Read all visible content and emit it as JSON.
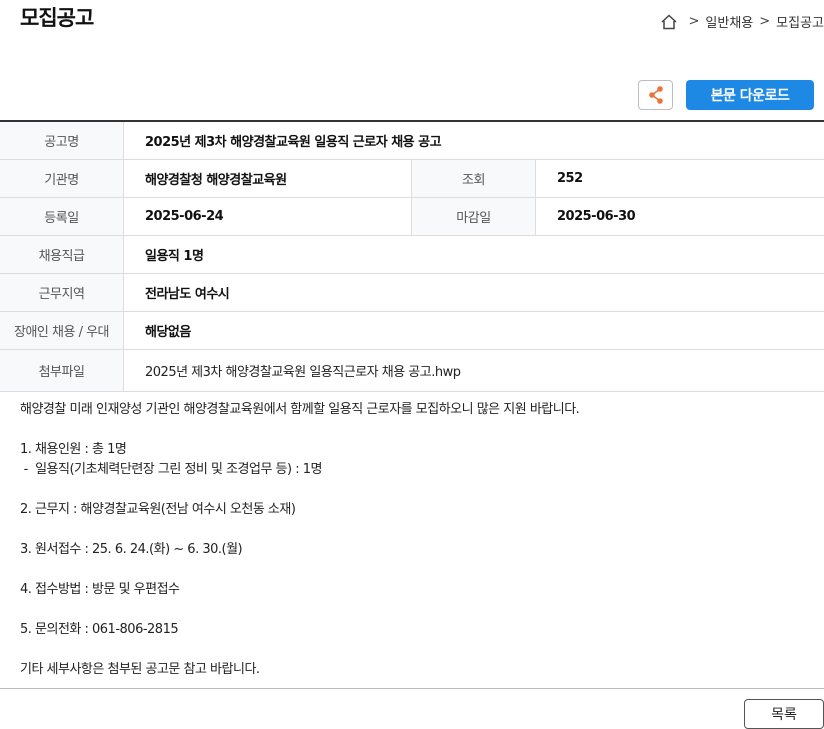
{
  "header": {
    "title": "모집공고",
    "breadcrumb": [
      "일반채용",
      "모집공고"
    ],
    "breadcrumb_sep": ">"
  },
  "toolbar": {
    "download_label": "본문 다운로드"
  },
  "info": {
    "title_label": "공고명",
    "title_value": "2025년 제3차 해양경찰교육원 일용직 근로자 채용 공고",
    "org_label": "기관명",
    "org_value": "해양경찰청 해양경찰교육원",
    "views_label": "조회",
    "views_value": "252",
    "reg_label": "등록일",
    "reg_value": "2025-06-24",
    "deadline_label": "마감일",
    "deadline_value": "2025-06-30",
    "grade_label": "채용직급",
    "grade_value": "일용직 1명",
    "region_label": "근무지역",
    "region_value": "전라남도 여수시",
    "disabled_label": "장애인 채용 / 우대",
    "disabled_value": "해당없음",
    "file_label": "첨부파일",
    "file_value": "2025년 제3차 해양경찰교육원 일용직근로자 채용 공고.hwp"
  },
  "body": {
    "intro": "해양경찰 미래 인재양성 기관인 해양경찰교육원에서 함께할 일용직 근로자를 모집하오니 많은 지원 바랍니다.",
    "item1": "1. 채용인원 : 총 1명",
    "item1_sub": " -  일용직(기초체력단련장 그린 정비 및 조경업무 등) : 1명",
    "item2": "2. 근무지 : 해양경찰교육원(전남 여수시 오천동 소재)",
    "item3": "3. 원서접수 : 25. 6. 24.(화) ~ 6. 30.(월)",
    "item4": "4. 접수방법 : 방문 및 우편접수",
    "item5": "5. 문의전화 : 061-806-2815",
    "outro": "기타 세부사항은 첨부된 공고문 참고 바랍니다."
  },
  "footer": {
    "list_label": "목록"
  },
  "colors": {
    "accent": "#1e88e5",
    "share_icon": "#e8743b"
  },
  "icons": {
    "home": "home-icon",
    "share": "share-icon"
  }
}
